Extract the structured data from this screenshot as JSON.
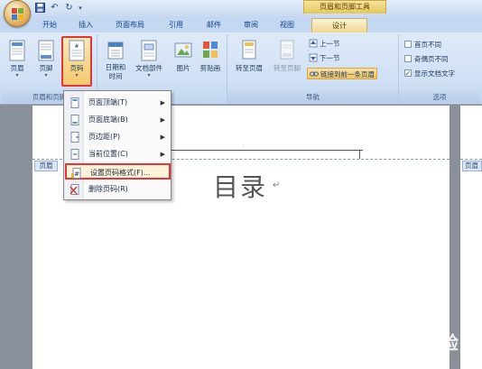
{
  "title_bar": {
    "contextual_tool": "页眉和页脚工具",
    "qat_icons": [
      "save-icon",
      "undo-icon",
      "redo-icon"
    ]
  },
  "tabs": [
    "开始",
    "插入",
    "页面布局",
    "引用",
    "邮件",
    "审阅",
    "视图",
    "设计"
  ],
  "active_tab": "设计",
  "ribbon": {
    "group1": {
      "label": "页眉和页脚",
      "buttons": [
        "页眉",
        "页脚",
        "页码"
      ]
    },
    "group2": {
      "buttons": [
        "日期和\n时间",
        "文档部件",
        "图片",
        "剪贴画"
      ]
    },
    "group3": {
      "label": "导航",
      "goto_header": "转至页眉",
      "goto_footer": "转至页脚",
      "prev_section": "上一节",
      "next_section": "下一节",
      "link_previous": "链接到前一条页眉"
    },
    "group4": {
      "label": "选项",
      "diff_first": "首页不同",
      "diff_odd_even": "奇偶页不同",
      "show_text": "显示文档文字"
    }
  },
  "menu": {
    "items": [
      {
        "label": "页面顶端(T)"
      },
      {
        "label": "页面底端(B)"
      },
      {
        "label": "页边距(P)"
      },
      {
        "label": "当前位置(C)"
      },
      {
        "label": "设置页码格式(F)..."
      },
      {
        "label": "删除页码(R)"
      }
    ]
  },
  "document": {
    "header_tag": "页眉",
    "header_tag_right": "页眉",
    "title": "目录"
  },
  "colors": {
    "accent_red": "#e53535",
    "ribbon_blue": "#cfe0f5",
    "context_gold": "#e8c65b"
  }
}
